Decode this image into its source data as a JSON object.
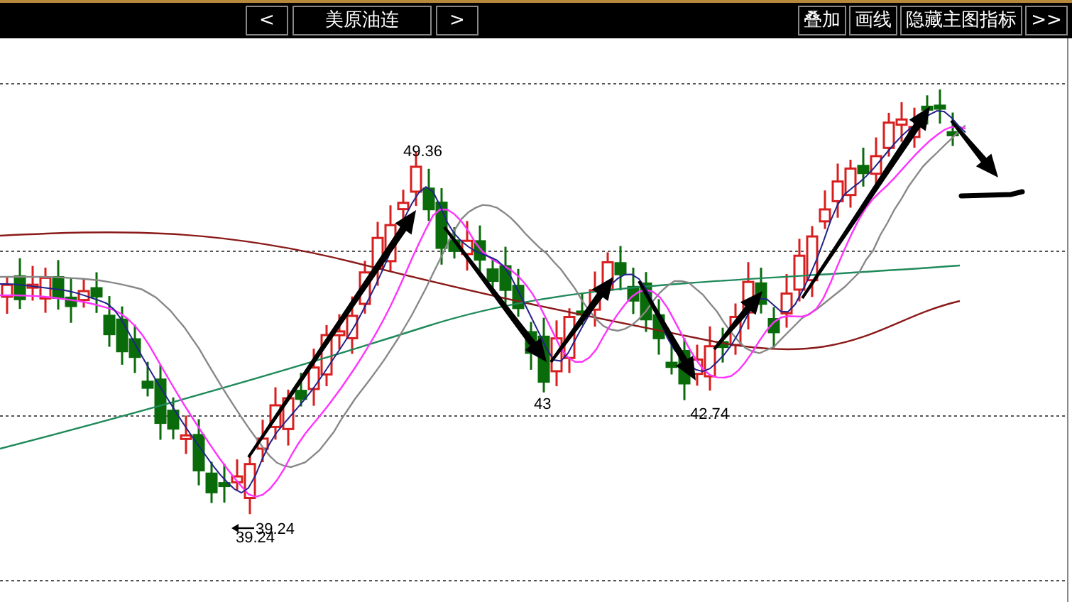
{
  "toolbar": {
    "prev_button": "<",
    "symbol": "美原油连",
    "next_button": ">",
    "actions": [
      "叠加",
      "画线",
      "隐藏主图指标"
    ],
    "more_button": ">>"
  },
  "chart": {
    "price_labels": [
      {
        "text": "49.36",
        "kind": "plain"
      },
      {
        "text": "43",
        "kind": "plain"
      },
      {
        "text": "42.74",
        "kind": "plain"
      },
      {
        "text": "39.24",
        "kind": "pointer"
      },
      {
        "text": "39.24",
        "kind": "plain"
      }
    ]
  }
}
